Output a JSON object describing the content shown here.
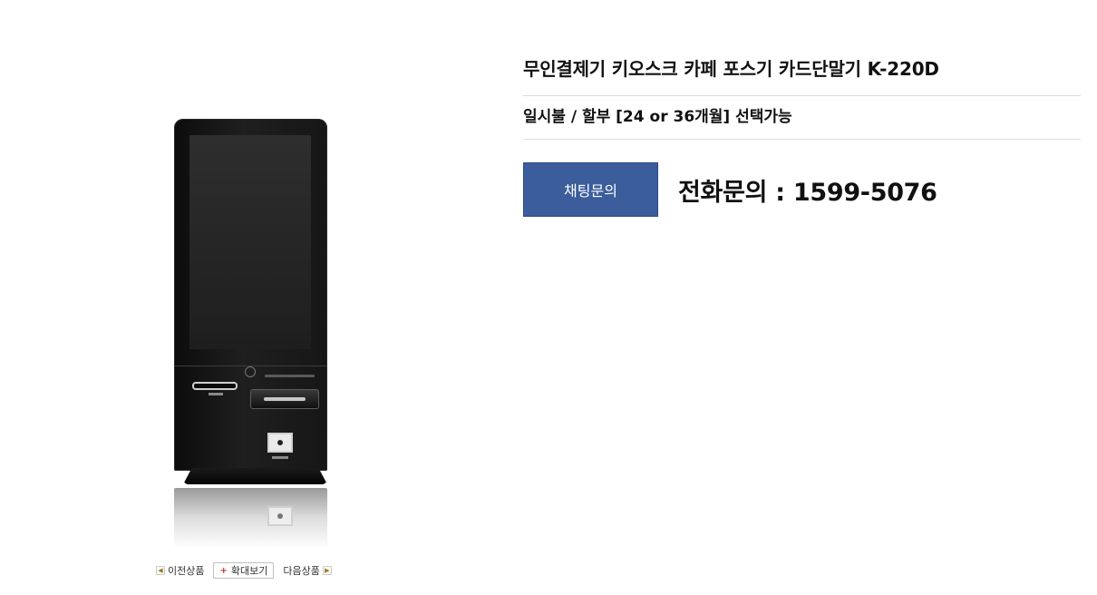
{
  "product": {
    "title": "무인결제기 키오스크 카페 포스기 카드단말기 K-220D",
    "subtitle": "일시불 / 할부 [24 or 36개월] 선택가능"
  },
  "contact": {
    "chat_label": "채팅문의",
    "phone_text": "전화문의 : 1599-5076"
  },
  "image_nav": {
    "prev_label": "이전상품",
    "zoom_label": "확대보기",
    "next_label": "다음상품"
  },
  "colors": {
    "chat_button": "#3b5d9c",
    "divider": "#dcdcdc"
  }
}
